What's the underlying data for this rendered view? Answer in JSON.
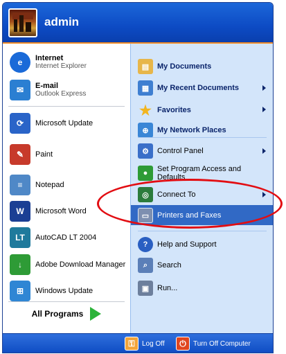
{
  "header": {
    "username": "admin"
  },
  "pinned": [
    {
      "title": "Internet",
      "subtitle": "Internet Explorer",
      "icon": "internet-explorer-icon",
      "color": "#1a6ad8"
    },
    {
      "title": "E-mail",
      "subtitle": "Outlook Express",
      "icon": "outlook-express-icon",
      "color": "#2b7fd2"
    }
  ],
  "recent": [
    {
      "label": "Microsoft Update",
      "icon": "microsoft-update-icon",
      "color": "#2a64c8"
    },
    {
      "label": "Paint",
      "icon": "paint-icon",
      "color": "#c73a2b"
    },
    {
      "label": "Notepad",
      "icon": "notepad-icon",
      "color": "#4f88c7"
    },
    {
      "label": "Microsoft Word",
      "icon": "microsoft-word-icon",
      "color": "#1b3f94"
    },
    {
      "label": "AutoCAD LT 2004",
      "icon": "autocad-icon",
      "color": "#1f7a9c"
    },
    {
      "label": "Adobe Download Manager",
      "icon": "adobe-download-manager-icon",
      "color": "#2e9b36"
    },
    {
      "label": "Windows Update",
      "icon": "windows-update-icon",
      "color": "#2f86d4"
    }
  ],
  "all_programs": "All Programs",
  "places": [
    {
      "label": "My Documents",
      "icon": "my-documents-icon",
      "color": "#e7b64a"
    },
    {
      "label": "My Recent Documents",
      "icon": "recent-documents-icon",
      "color": "#3f7fd1"
    },
    {
      "label": "Favorites",
      "icon": "favorites-star-icon",
      "color": "#f2b51f"
    },
    {
      "label": "My Network Places",
      "icon": "network-places-icon",
      "color": "#3a86d6"
    }
  ],
  "system": [
    {
      "label": "Control Panel",
      "icon": "control-panel-icon",
      "color": "#3a6fc9"
    },
    {
      "label": "Set Program Access and Defaults",
      "icon": "program-access-icon",
      "color": "#2e9b36"
    },
    {
      "label": "Connect To",
      "icon": "connect-to-icon",
      "color": "#2c7c3c"
    },
    {
      "label": "Printers and Faxes",
      "icon": "printers-faxes-icon",
      "color": "#7d8fb0"
    }
  ],
  "help": [
    {
      "label": "Help and Support",
      "icon": "help-icon",
      "color": "#2a5fc2"
    },
    {
      "label": "Search",
      "icon": "search-icon",
      "color": "#5b7fb8"
    },
    {
      "label": "Run...",
      "icon": "run-icon",
      "color": "#6d7f9c"
    }
  ],
  "footer": {
    "logoff": "Log Off",
    "turnoff": "Turn Off Computer"
  },
  "annotation": {
    "color": "#e20d12"
  }
}
